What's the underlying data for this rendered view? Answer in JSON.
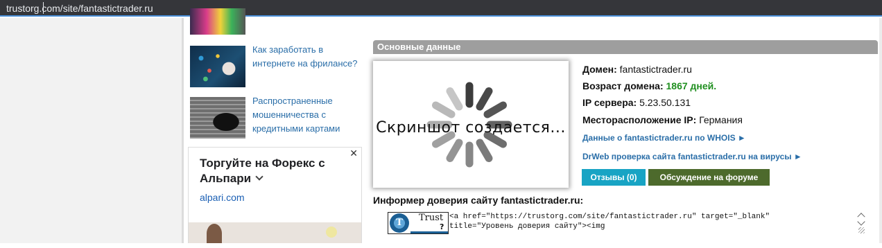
{
  "browser": {
    "url": "trustorg.com/site/fantastictrader.ru"
  },
  "sidebar": {
    "articles": [
      {
        "title": "Как заработать в интернете на фрилансе?"
      },
      {
        "title": "Распространенные мошенничества с кредитными картами"
      }
    ],
    "ad": {
      "close_glyph": "✕",
      "title": "Торгуйте на Форекс с Альпари",
      "domain": "alpari.com"
    }
  },
  "main": {
    "section_title": "Основные данные",
    "screenshot_text": "Скриншот создается...",
    "info": {
      "domain_label": "Домен:",
      "domain_value": "fantastictrader.ru",
      "age_label": "Возраст домена:",
      "age_value": "1867 дней.",
      "ip_label": "IP сервера:",
      "ip_value": "5.23.50.131",
      "location_label": "Месторасположение IP:",
      "location_value": "Германия",
      "whois_link": "Данные о fantastictrader.ru по WHOIS ►",
      "drweb_link": "DrWeb проверка сайта fantastictrader.ru на вирусы ►"
    },
    "buttons": {
      "reviews": "Отзывы (0)",
      "forum": "Обсуждение на форуме"
    },
    "informer": {
      "title": "Информер доверия сайту fantastictrader.ru:",
      "badge_logo": "T",
      "badge_trust": "Trust",
      "badge_q": "?",
      "code_line1": "<a href=\"https://trustorg.com/site/fantastictrader.ru\" target=\"_blank\"",
      "code_line2": "title=\"Уровень доверия сайту\"><img"
    }
  },
  "colors": {
    "section_header": "#9e9e9e",
    "link": "#2a6ea8",
    "age_green": "#1f8f1f",
    "reviews_button": "#18a4c4",
    "forum_button": "#4d6a2c"
  }
}
